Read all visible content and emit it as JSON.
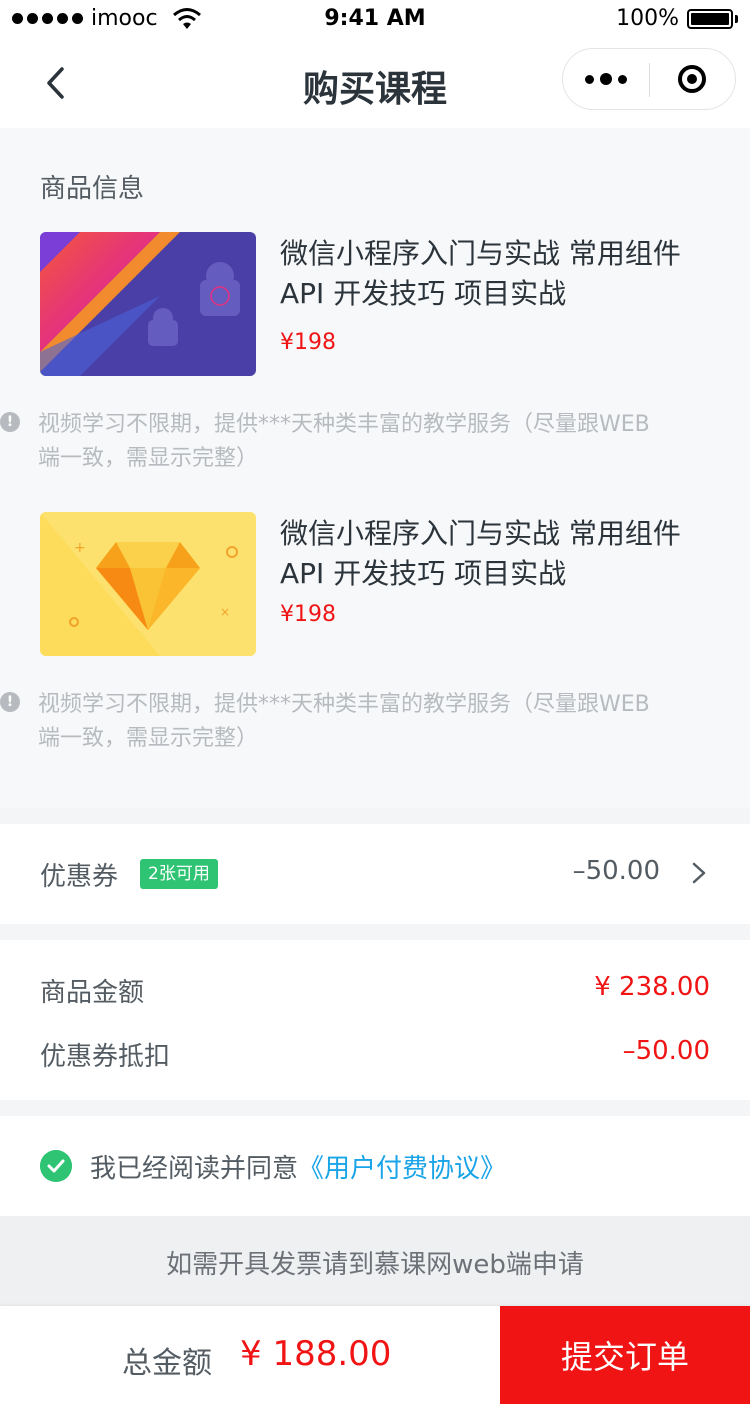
{
  "status_bar": {
    "carrier": "imooc",
    "time": "9:41 AM",
    "battery": "100%"
  },
  "nav": {
    "title": "购买课程"
  },
  "products_section": {
    "title": "商品信息",
    "items": [
      {
        "title": "微信小程序入门与实战 常用组件API 开发技巧 项目实战",
        "price": "¥198",
        "note": "视频学习不限期，提供***天种类丰富的教学服务（尽量跟WEB端一致，需显示完整）",
        "thumb_icon": "android-course-thumbnail"
      },
      {
        "title": "微信小程序入门与实战 常用组件API 开发技巧 项目实战",
        "price": "¥198",
        "note": "视频学习不限期，提供***天种类丰富的教学服务（尽量跟WEB端一致，需显示完整）",
        "thumb_icon": "sketch-diamond-thumbnail"
      }
    ]
  },
  "coupon": {
    "label": "优惠券",
    "badge": "2张可用",
    "value": "–50.00"
  },
  "amounts": [
    {
      "label": "商品金额",
      "value": "¥ 238.00"
    },
    {
      "label": "优惠券抵扣",
      "value": "–50.00"
    }
  ],
  "agreement": {
    "text": "我已经阅读并同意",
    "link": "《用户付费协议》"
  },
  "invoice_note": "如需开具发票请到慕课网web端申请",
  "footer": {
    "total_label": "总金额",
    "total_value": "¥ 188.00",
    "submit_label": "提交订单"
  },
  "colors": {
    "accent_red": "#f01414",
    "green": "#2ec473",
    "link_blue": "#1aa4e8"
  }
}
